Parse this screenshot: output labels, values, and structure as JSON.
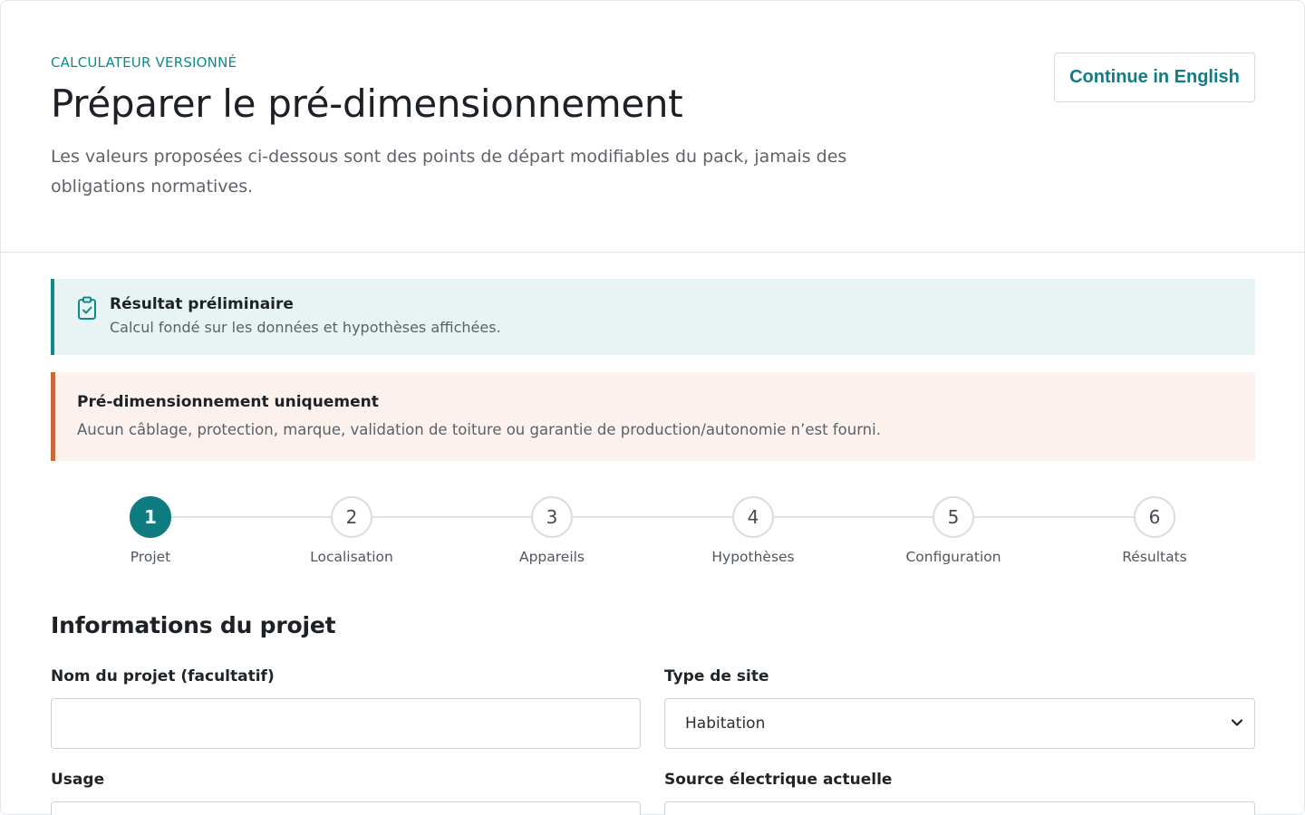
{
  "header": {
    "eyebrow": "CALCULATEUR VERSIONNÉ",
    "title": "Préparer le pré-dimensionnement",
    "subtitle": "Les valeurs proposées ci-dessous sont des points de départ modifiables du pack, jamais des obligations normatives.",
    "language_button": "Continue in English"
  },
  "alerts": {
    "info": {
      "icon": "clipboard-check-icon",
      "title": "Résultat préliminaire",
      "text": "Calcul fondé sur les données et hypothèses affichées."
    },
    "warning": {
      "title": "Pré-dimensionnement uniquement",
      "text": "Aucun câblage, protection, marque, validation de toiture ou garantie de production/autonomie n’est fourni."
    }
  },
  "stepper": {
    "current": 1,
    "steps": [
      {
        "number": "1",
        "label": "Projet"
      },
      {
        "number": "2",
        "label": "Localisation"
      },
      {
        "number": "3",
        "label": "Appareils"
      },
      {
        "number": "4",
        "label": "Hypothèses"
      },
      {
        "number": "5",
        "label": "Configuration"
      },
      {
        "number": "6",
        "label": "Résultats"
      }
    ]
  },
  "form": {
    "section_title": "Informations du projet",
    "project_name": {
      "label": "Nom du projet (facultatif)",
      "value": ""
    },
    "site_type": {
      "label": "Type de site",
      "value": "Habitation"
    },
    "usage": {
      "label": "Usage"
    },
    "power_source": {
      "label": "Source électrique actuelle"
    }
  },
  "colors": {
    "accent": "#0e7c80",
    "info_bg": "#e8f4f4",
    "warning_bg": "#fcf1ec",
    "warning_border": "#c86b3a"
  }
}
